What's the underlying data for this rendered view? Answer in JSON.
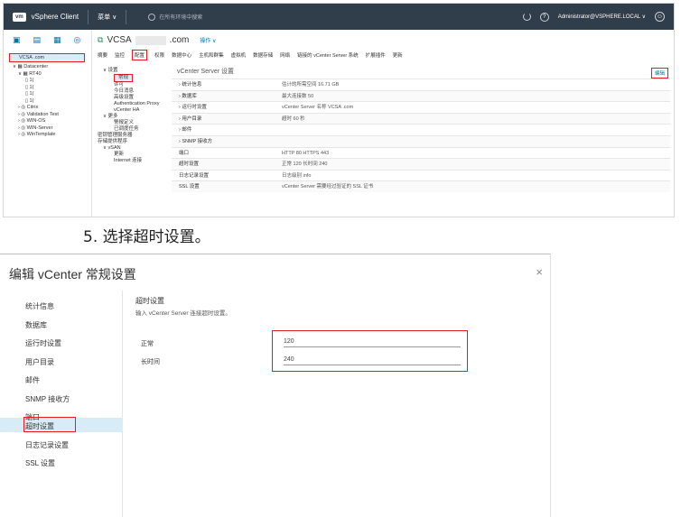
{
  "shot1": {
    "topbar": {
      "logo": "vm",
      "app_title": "vSphere Client",
      "menu": "菜单 ∨",
      "search_placeholder": "在所有环境中搜索",
      "help": "?",
      "user": "Administrator@VSPHERE.LOCAL ∨",
      "smiley": "☺"
    },
    "nav": {
      "icons": [
        "▣",
        "▤",
        "▦",
        "◎"
      ],
      "selected_item": "VCSA    .com",
      "tree": [
        {
          "level": "lv1",
          "text": "∨ ▦ Datacenter"
        },
        {
          "level": "lv2",
          "text": "∨ ▦ RT40"
        },
        {
          "level": "lv3",
          "text": "▯ 1("
        },
        {
          "level": "lv3",
          "text": "▯ 1("
        },
        {
          "level": "lv3",
          "text": "▯ 1("
        },
        {
          "level": "lv3",
          "text": "▯ 1("
        },
        {
          "level": "lv2",
          "text": "› ◎ Citrix"
        },
        {
          "level": "lv2",
          "text": "› ◎ Validation Test"
        },
        {
          "level": "lv2",
          "text": "› ◎ WIN-OS"
        },
        {
          "level": "lv2",
          "text": "› ◎ WIN-Server"
        },
        {
          "level": "lv2",
          "text": "› ◎ WinTemplate"
        }
      ]
    },
    "object": {
      "name_prefix": "VCSA",
      "name_suffix": ".com",
      "actions": "操作 ∨",
      "tabs": [
        "摘要",
        "监控",
        "配置",
        "权限",
        "数据中心",
        "主机和群集",
        "虚拟机",
        "数据存储",
        "网络",
        "链接的 vCenter Server 系统",
        "扩展插件",
        "更新"
      ],
      "active_tab": "配置"
    },
    "settings_tree": [
      {
        "cls": "grp",
        "text": "∨ 设置",
        "active": false
      },
      {
        "cls": "sub",
        "text": "常规",
        "active": true
      },
      {
        "cls": "sub",
        "text": "许可",
        "active": false
      },
      {
        "cls": "sub",
        "text": "今日消息",
        "active": false
      },
      {
        "cls": "sub",
        "text": "高级设置",
        "active": false
      },
      {
        "cls": "sub",
        "text": "Authentication Proxy",
        "active": false
      },
      {
        "cls": "sub",
        "text": "vCenter HA",
        "active": false
      },
      {
        "cls": "grp",
        "text": "∨ 更多",
        "active": false
      },
      {
        "cls": "sub",
        "text": "警报定义",
        "active": false
      },
      {
        "cls": "sub",
        "text": "已调度任务",
        "active": false
      },
      {
        "cls": "",
        "text": "密钥管理服务器",
        "active": false
      },
      {
        "cls": "",
        "text": "存储提供程序",
        "active": false
      },
      {
        "cls": "grp",
        "text": "∨ vSAN",
        "active": false
      },
      {
        "cls": "sub",
        "text": "更新",
        "active": false
      },
      {
        "cls": "sub",
        "text": "Internet 连接",
        "active": false
      }
    ],
    "detail": {
      "title": "vCenter Server 设置",
      "edit": "编辑",
      "rows": [
        {
          "k": "› 统计信息",
          "v": "估计的所需空间 16.71 GB"
        },
        {
          "k": "› 数据库",
          "v": "最大连接数 50"
        },
        {
          "k": "› 运行时设置",
          "v": "vCenter Server 名称 VCSA          .com"
        },
        {
          "k": "› 用户目录",
          "v": "超时 60 秒"
        },
        {
          "k": "› 邮件",
          "v": ""
        },
        {
          "k": "› SNMP 接收方",
          "v": ""
        },
        {
          "k": "  端口",
          "v": "HTTP 80    HTTPS 443"
        },
        {
          "k": "  超时设置",
          "v": "正常 120    长时间 240"
        },
        {
          "k": "  日志记录设置",
          "v": "日志级别 info"
        },
        {
          "k": "  SSL 设置",
          "v": "vCenter Server 需要经过验证的 SSL 证书"
        }
      ]
    }
  },
  "step_caption": "5. 选择超时设置。",
  "dialog": {
    "title": "编辑 vCenter 常规设置",
    "close": "×",
    "nav": [
      "统计信息",
      "数据库",
      "运行时设置",
      "用户目录",
      "邮件",
      "SNMP 接收方",
      "端口",
      "超时设置",
      "日志记录设置",
      "SSL 设置"
    ],
    "active_nav": "超时设置",
    "section_title": "超时设置",
    "section_desc": "输入 vCenter Server 连接超时设置。",
    "fields": [
      {
        "label": "正常",
        "value": "120"
      },
      {
        "label": "长时间",
        "value": "240"
      }
    ]
  }
}
